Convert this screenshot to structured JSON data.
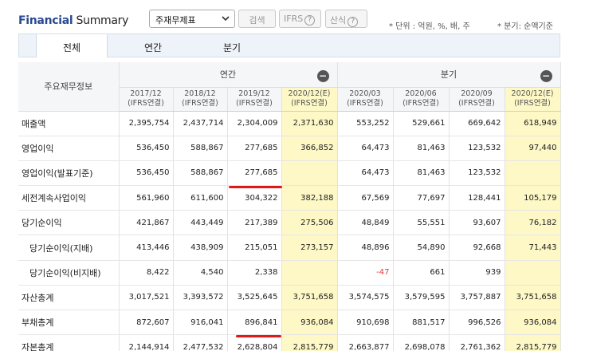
{
  "header": {
    "title_part1": "Financial",
    "title_part2": "Summary",
    "select_value": "주재무제표",
    "search_label": "검색",
    "ifrs_label": "IFRS",
    "calc_label": "산식",
    "help_glyph": "?",
    "note_unit": "* 단위 : 억원, %, 배, 주",
    "note_quarter": "* 분기: 순액기준"
  },
  "tabs": [
    {
      "label": "전체",
      "active": true
    },
    {
      "label": "연간",
      "active": false
    },
    {
      "label": "분기",
      "active": false
    }
  ],
  "table": {
    "label_header": "주요재무정보",
    "group_annual": "연간",
    "group_quarter": "분기",
    "collapse_glyph": "−",
    "columns": [
      {
        "period": "2017/12",
        "basis": "(IFRS연결)",
        "highlight": false
      },
      {
        "period": "2018/12",
        "basis": "(IFRS연결)",
        "highlight": false
      },
      {
        "period": "2019/12",
        "basis": "(IFRS연결)",
        "highlight": false
      },
      {
        "period": "2020/12(E)",
        "basis": "(IFRS연결)",
        "highlight": true
      },
      {
        "period": "2020/03",
        "basis": "(IFRS연결)",
        "highlight": false
      },
      {
        "period": "2020/06",
        "basis": "(IFRS연결)",
        "highlight": false
      },
      {
        "period": "2020/09",
        "basis": "(IFRS연결)",
        "highlight": false
      },
      {
        "period": "2020/12(E)",
        "basis": "(IFRS연결)",
        "highlight": true
      }
    ],
    "rows": [
      {
        "label": "매출액",
        "indent": false,
        "values": [
          "2,395,754",
          "2,437,714",
          "2,304,009",
          "2,371,630",
          "553,252",
          "529,661",
          "669,642",
          "618,949"
        ]
      },
      {
        "label": "영업이익",
        "indent": false,
        "values": [
          "536,450",
          "588,867",
          "277,685",
          "366,852",
          "64,473",
          "81,463",
          "123,532",
          "97,440"
        ]
      },
      {
        "label": "영업이익(발표기준)",
        "indent": false,
        "values": [
          "536,450",
          "588,867",
          "277,685",
          "",
          "64,473",
          "81,463",
          "123,532",
          ""
        ]
      },
      {
        "label": "세전계속사업이익",
        "indent": false,
        "values": [
          "561,960",
          "611,600",
          "304,322",
          "382,188",
          "67,569",
          "77,697",
          "128,441",
          "105,179"
        ]
      },
      {
        "label": "당기순이익",
        "indent": false,
        "values": [
          "421,867",
          "443,449",
          "217,389",
          "275,506",
          "48,849",
          "55,551",
          "93,607",
          "76,182"
        ]
      },
      {
        "label": "당기순이익(지배)",
        "indent": true,
        "values": [
          "413,446",
          "438,909",
          "215,051",
          "273,157",
          "48,896",
          "54,890",
          "92,668",
          "71,443"
        ]
      },
      {
        "label": "당기순이익(비지배)",
        "indent": true,
        "values": [
          "8,422",
          "4,540",
          "2,338",
          "",
          "-47",
          "661",
          "939",
          ""
        ]
      },
      {
        "label": "자산총계",
        "indent": false,
        "values": [
          "3,017,521",
          "3,393,572",
          "3,525,645",
          "3,751,658",
          "3,574,575",
          "3,579,595",
          "3,757,887",
          "3,751,658"
        ]
      },
      {
        "label": "부채총계",
        "indent": false,
        "values": [
          "872,607",
          "916,041",
          "896,841",
          "936,084",
          "910,698",
          "881,517",
          "996,526",
          "936,084"
        ]
      },
      {
        "label": "자본총계",
        "indent": false,
        "values": [
          "2,144,914",
          "2,477,532",
          "2,628,804",
          "2,815,779",
          "2,663,877",
          "2,698,078",
          "2,761,362",
          "2,815,779"
        ]
      }
    ]
  },
  "colors": {
    "title_blue": "#2a4a93",
    "highlight_yellow": "#fdf8c6",
    "negative_red": "#e23a3a",
    "annotation_red": "#e01919"
  }
}
